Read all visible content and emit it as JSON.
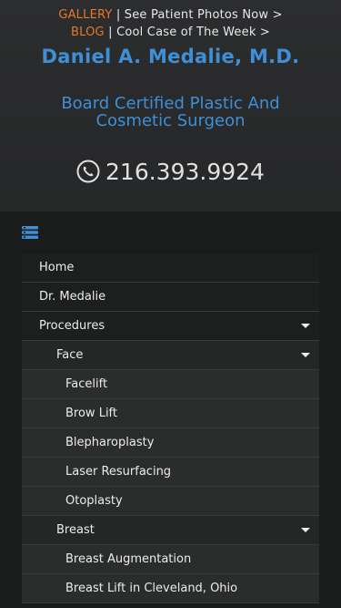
{
  "header": {
    "promo1": {
      "accent": "GALLERY",
      "sep": " | ",
      "text": "See Patient Photos Now >"
    },
    "promo2": {
      "accent": "BLOG",
      "sep": " | ",
      "text": "Cool Case of The Week >"
    },
    "name": "Daniel A. Medalie, M.D.",
    "tagline": "Board Certified Plastic And Cosmetic Surgeon",
    "phone": "216.393.9924",
    "phone_icon": "phone-icon"
  },
  "nav": {
    "toggle_icon": "menu-list-icon",
    "items": [
      {
        "label": "Home",
        "level": 0,
        "has_children": false
      },
      {
        "label": "Dr. Medalie",
        "level": 0,
        "has_children": false
      },
      {
        "label": "Procedures",
        "level": 0,
        "has_children": true
      },
      {
        "label": "Face",
        "level": 1,
        "has_children": true
      },
      {
        "label": "Facelift",
        "level": 2,
        "has_children": false
      },
      {
        "label": "Brow Lift",
        "level": 2,
        "has_children": false
      },
      {
        "label": "Blepharoplasty",
        "level": 2,
        "has_children": false
      },
      {
        "label": "Laser Resurfacing",
        "level": 2,
        "has_children": false
      },
      {
        "label": "Otoplasty",
        "level": 2,
        "has_children": false
      },
      {
        "label": "Breast",
        "level": 1,
        "has_children": true
      },
      {
        "label": "Breast Augmentation",
        "level": 2,
        "has_children": false
      },
      {
        "label": "Breast Lift in Cleveland, Ohio",
        "level": 2,
        "has_children": false
      }
    ]
  },
  "colors": {
    "accent": "#e8782a",
    "brand_blue": "#3f8fd6",
    "background": "#1f2021"
  }
}
